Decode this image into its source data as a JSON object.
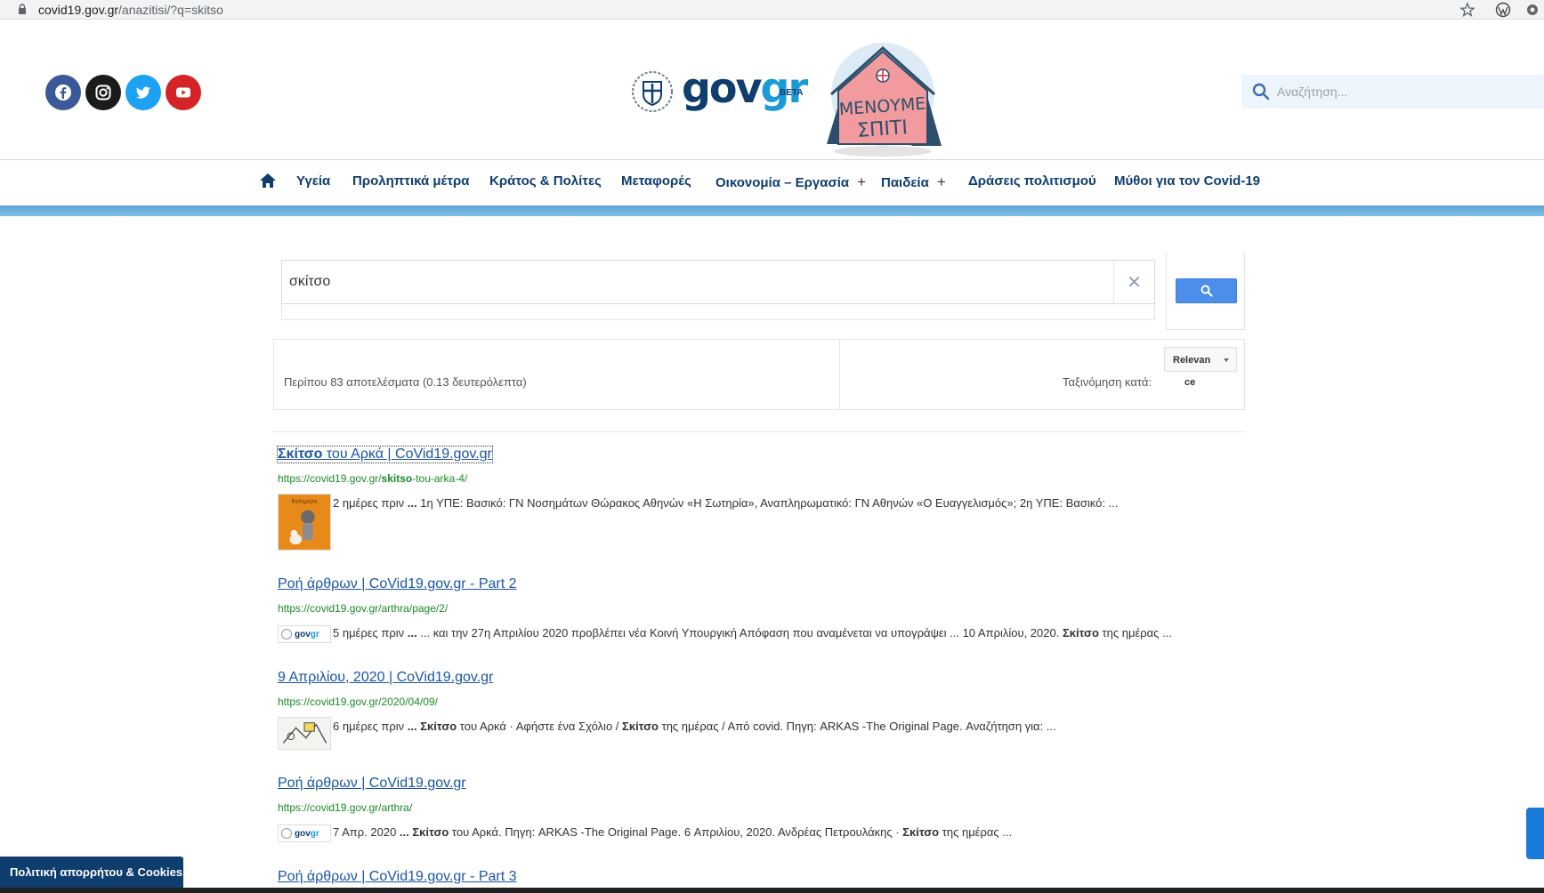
{
  "browser": {
    "url_host": "covid19.gov.gr",
    "url_path": "/anazitisi/?q=skitso"
  },
  "header": {
    "logo": {
      "main": "gov",
      "accent": "gr",
      "badge": "BETA"
    },
    "campaign_text": "ΜΕΝΟΥΜΕ ΣΠΙΤΙ",
    "search_placeholder": "Αναζήτηση..."
  },
  "nav": {
    "items": [
      {
        "label": "Υγεία"
      },
      {
        "label": "Προληπτικά μέτρα"
      },
      {
        "label": "Κράτος & Πολίτες"
      },
      {
        "label": "Μεταφορές"
      },
      {
        "label": "Οικονομία – Εργασία",
        "expand": "+"
      },
      {
        "label": "Παιδεία",
        "expand": "+"
      },
      {
        "label": "Δράσεις πολιτισμού"
      },
      {
        "label": "Μύθοι για τον Covid-19"
      }
    ]
  },
  "search": {
    "query": "σκίτσο",
    "clear_glyph": "✕"
  },
  "info": {
    "count_text": "Περίπου 83 αποτελέσματα (0.13 δευτερόλεπτα)",
    "sort_label": "Ταξινόμηση κατά:",
    "sort_value": "Relevan",
    "sort_value_overflow": "ce"
  },
  "results": [
    {
      "title_bold": "Σκίτσο",
      "title_rest": " του Αρκά | CoVid19.gov.gr",
      "url_pre": "https://covid19.gov.gr/",
      "url_bold": "skitso",
      "url_post": "-tou-arka-4/",
      "snippet_pre": "2 ημέρες πριν ",
      "snippet_bold": "...",
      "snippet_post": " 1η ΥΠΕ: Βασικό: ΓΝ Νοσημάτων Θώρακος Αθηνών «Η Σωτηρία», Αναπληρωματικό: ΓΝ Αθηνών «Ο Ευαγγελισμός»; 2η ΥΠΕ: Βασικό: ...",
      "thumb_label": "Καλημέρα"
    },
    {
      "title": "Ροή άρθρων | CoVid19.gov.gr - Part 2",
      "url": "https://covid19.gov.gr/arthra/page/2/",
      "snippet_pre": "5 ημέρες πριν ",
      "snippet_bold": "...",
      "snippet_mid": " ... και την 27η Απριλίου 2020 προβλέπει νέα Κοινή Υπουργική Απόφαση που αναμένεται να υπογράψει ... 10 Απριλίου, 2020. ",
      "snippet_bold2": "Σκίτσο",
      "snippet_post": " της ημέρας ...",
      "thumb_label": "gov",
      "thumb_accent": "gr"
    },
    {
      "title": "9 Απριλίου, 2020 | CoVid19.gov.gr",
      "url": "https://covid19.gov.gr/2020/04/09/",
      "snippet_pre": "6 ημέρες πριν ",
      "snippet_bold": "... Σκίτσο",
      "snippet_mid": " του Αρκά · Αφήστε ένα Σχόλιο / ",
      "snippet_bold2": "Σκίτσο",
      "snippet_post": " της ημέρας / Από covid. Πηγη: ARKAS -The Original Page. Αναζήτηση για: ..."
    },
    {
      "title": "Ροή άρθρων | CoVid19.gov.gr",
      "url": "https://covid19.gov.gr/arthra/",
      "snippet_pre": "7 Απρ. 2020 ",
      "snippet_bold": "... Σκίτσο",
      "snippet_mid": " του Αρκά. Πηγη: ARKAS -The Original Page. 6 Απριλίου, 2020. Ανδρέας Πετρουλάκης · ",
      "snippet_bold2": "Σκίτσο",
      "snippet_post": " της ημέρας ...",
      "thumb_label": "gov",
      "thumb_accent": "gr"
    },
    {
      "title": "Ροή άρθρων | CoVid19.gov.gr - Part 3"
    }
  ],
  "cookie_bar": "Πολιτική απορρήτου & Cookies",
  "colors": {
    "brand_navy": "#0e3d6e",
    "brand_blue": "#1a9ad7",
    "link": "#1a55a5",
    "url_green": "#1a8a28",
    "search_button": "#4c8ee9"
  },
  "icons": [
    "lock-icon",
    "star-icon",
    "wordpress-icon",
    "extension-icon",
    "facebook-icon",
    "instagram-icon",
    "twitter-icon",
    "youtube-icon",
    "search-icon",
    "home-icon",
    "clear-icon"
  ]
}
